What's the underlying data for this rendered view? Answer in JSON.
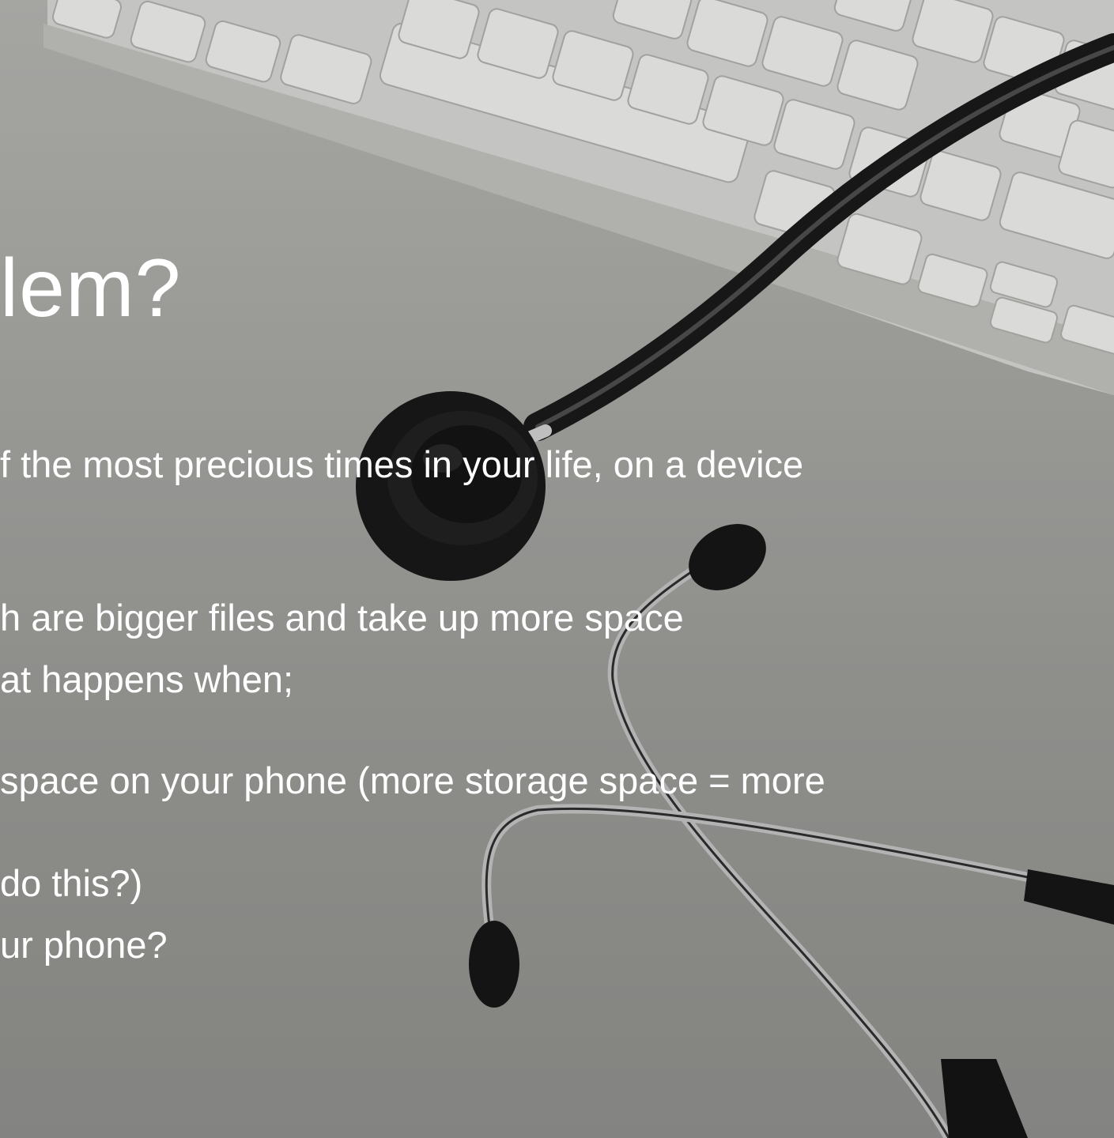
{
  "slide": {
    "title": "lem?",
    "lines": [
      "f the most precious times in your life, on a device",
      "h are bigger files and take up more space",
      "at happens when;",
      "space on your phone (more storage space = more",
      "do this?)",
      "ur phone?"
    ]
  },
  "background": {
    "description_icons": [
      "keyboard-image",
      "stethoscope-image"
    ],
    "colors": {
      "desk": "#a3a39f",
      "keyboard": "#d8d8d6",
      "stethoscope": "#1a1a1a",
      "text": "#ffffff"
    }
  }
}
